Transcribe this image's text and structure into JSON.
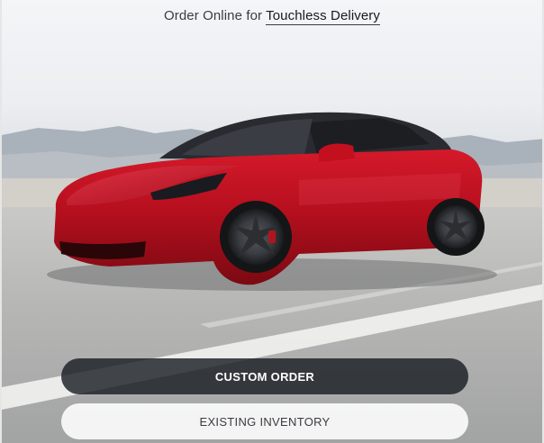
{
  "hero": {
    "subtitle_prefix": "Order Online for",
    "subtitle_link": "Touchless Delivery"
  },
  "actions": {
    "primary_label": "CUSTOM ORDER",
    "secondary_label": "EXISTING INVENTORY"
  },
  "colors": {
    "car_red": "#b0101a",
    "primary_button_bg": "#3e3d42",
    "secondary_button_bg": "#ffffff",
    "text_dark": "#393c41"
  }
}
